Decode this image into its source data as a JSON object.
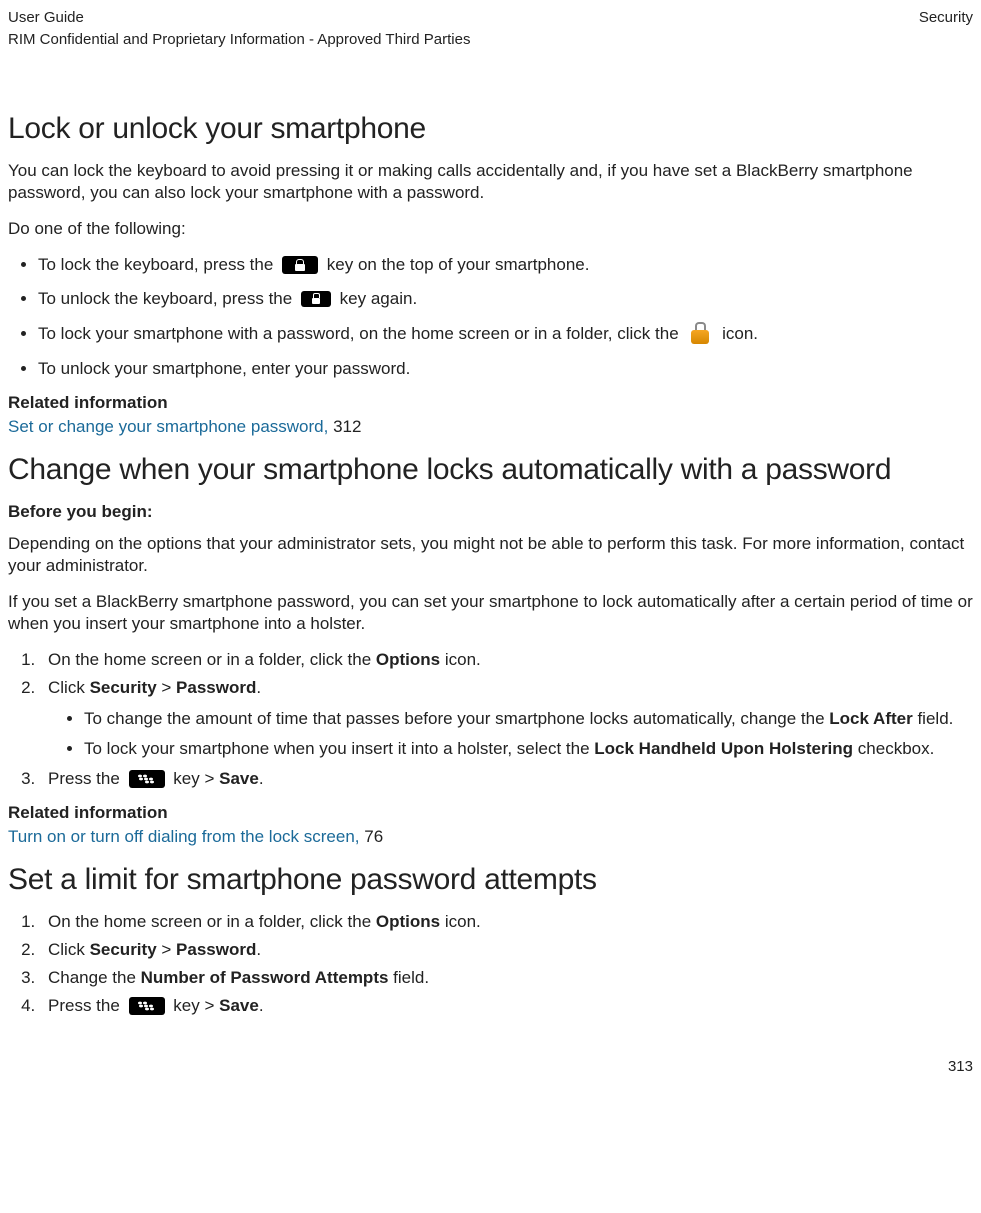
{
  "header": {
    "left": "User Guide",
    "right": "Security",
    "sub": "RIM Confidential and Proprietary Information - Approved Third Parties"
  },
  "section1": {
    "title": "Lock or unlock your smartphone",
    "intro": "You can lock the keyboard to avoid pressing it or making calls accidentally and, if you have set a BlackBerry smartphone password, you can also lock your smartphone with a password.",
    "do_one": "Do one of the following:",
    "b1a": "To lock the keyboard, press the ",
    "b1b": " key on the top of your smartphone.",
    "b2a": "To unlock the keyboard, press the ",
    "b2b": " key again.",
    "b3a": "To lock your smartphone with a password, on the home screen or in a folder, click the ",
    "b3b": " icon.",
    "b4": "To unlock your smartphone, enter your password.",
    "rel_hdr": "Related information",
    "rel_link": "Set or change your smartphone password, ",
    "rel_page": "312"
  },
  "section2": {
    "title": "Change when your smartphone locks automatically with a password",
    "before": "Before you begin:",
    "p1": "Depending on the options that your administrator sets, you might not be able to perform this task. For more information, contact your administrator.",
    "p2": "If you set a BlackBerry smartphone password, you can set your smartphone to lock automatically after a certain period of time or when you insert your smartphone into a holster.",
    "step1a": "On the home screen or in a folder, click the ",
    "step1b": "Options",
    "step1c": " icon.",
    "step2a": "Click ",
    "step2b": "Security",
    "step2c": " > ",
    "step2d": "Password",
    "step2e": ".",
    "sub1a": "To change the amount of time that passes before your smartphone locks automatically, change the ",
    "sub1b": "Lock After",
    "sub1c": " field.",
    "sub2a": "To lock your smartphone when you insert it into a holster, select the ",
    "sub2b": "Lock Handheld Upon Holstering",
    "sub2c": " checkbox.",
    "step3a": "Press the ",
    "step3b": " key > ",
    "step3c": "Save",
    "step3d": ".",
    "rel_hdr": "Related information",
    "rel_link": "Turn on or turn off dialing from the lock screen, ",
    "rel_page": "76"
  },
  "section3": {
    "title": "Set a limit for smartphone password attempts",
    "step1a": "On the home screen or in a folder, click the ",
    "step1b": "Options",
    "step1c": " icon.",
    "step2a": "Click ",
    "step2b": "Security",
    "step2c": " > ",
    "step2d": "Password",
    "step2e": ".",
    "step3a": "Change the ",
    "step3b": "Number of Password Attempts",
    "step3c": " field.",
    "step4a": "Press the ",
    "step4b": " key > ",
    "step4c": "Save",
    "step4d": "."
  },
  "page_number": "313"
}
